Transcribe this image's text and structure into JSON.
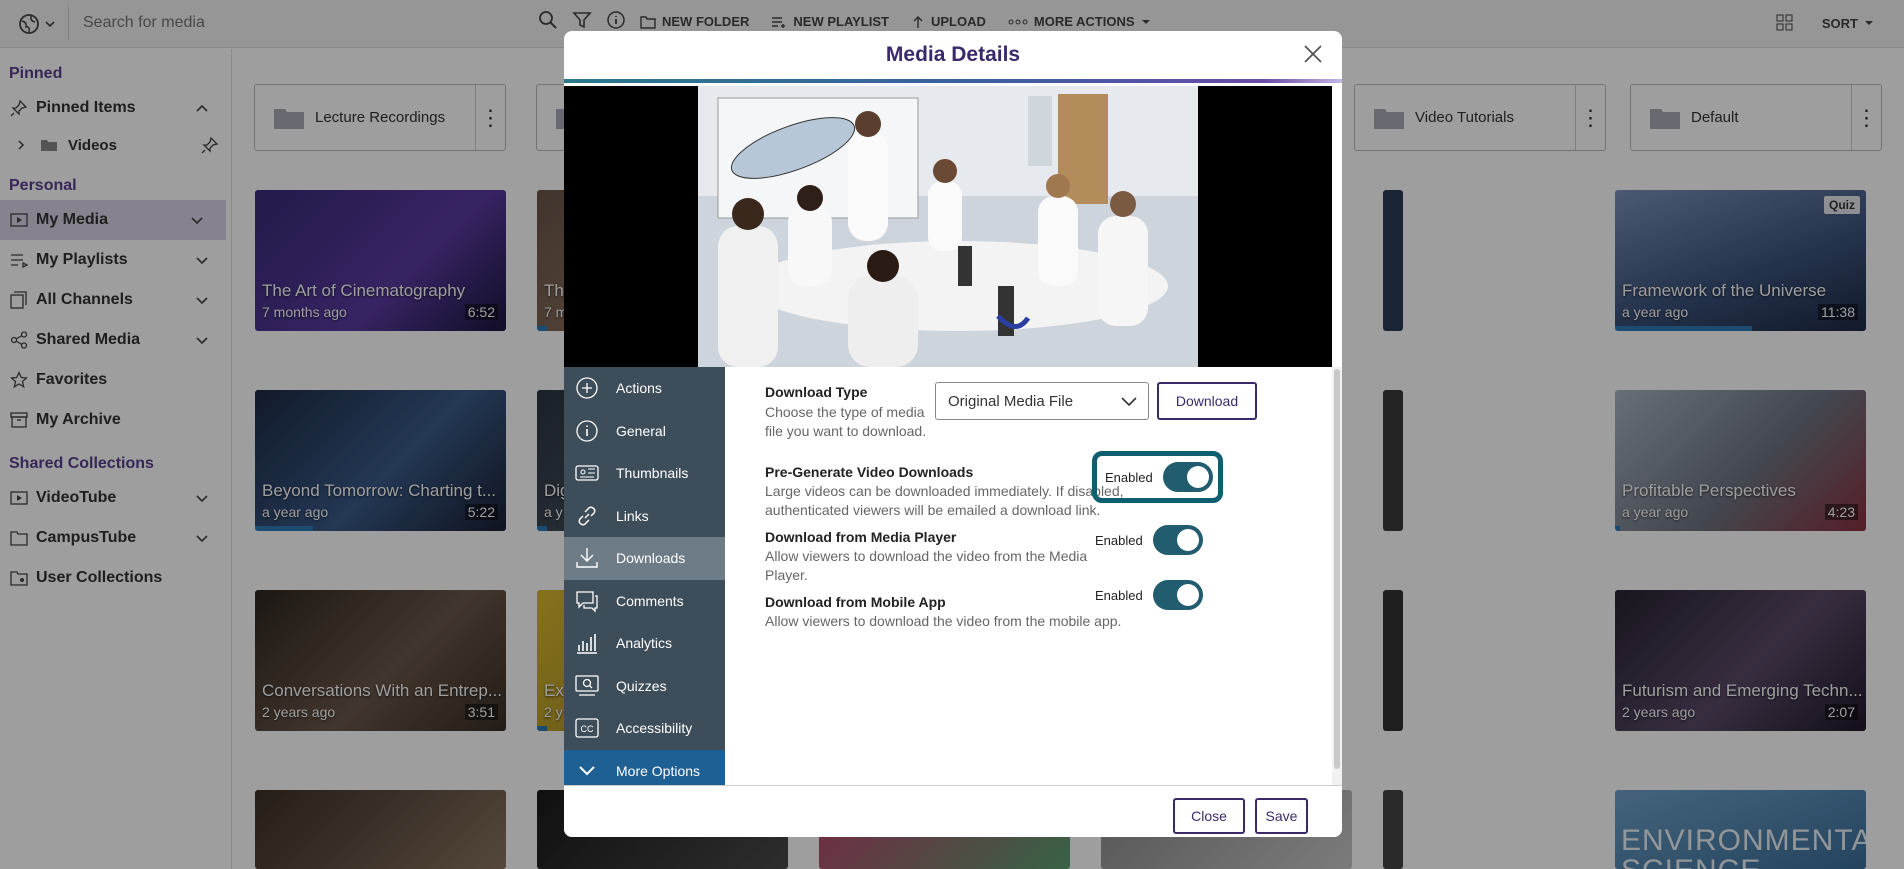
{
  "topbar": {
    "search_placeholder": "Search for media",
    "actions": [
      "NEW FOLDER",
      "NEW PLAYLIST",
      "UPLOAD",
      "MORE ACTIONS"
    ],
    "sort_label": "SORT"
  },
  "sidebar": {
    "pinned_header": "Pinned",
    "pinned_items_label": "Pinned Items",
    "pinned_sub": "Videos",
    "personal_header": "Personal",
    "personal_items": [
      "My Media",
      "My Playlists",
      "All Channels",
      "Shared Media",
      "Favorites",
      "My Archive"
    ],
    "shared_header": "Shared Collections",
    "shared_items": [
      "VideoTube",
      "CampusTube",
      "User Collections"
    ]
  },
  "folders": [
    "Lecture Recordings",
    "Video Tutorials",
    "Default"
  ],
  "media": [
    {
      "title": "The Art of Cinematography",
      "age": "7 months ago",
      "duration": "6:52"
    },
    {
      "title": "Th",
      "age": "7 m",
      "duration": ""
    },
    {
      "title": "Framework of the Universe",
      "age": "a year ago",
      "duration": "11:38",
      "quiz": "Quiz"
    },
    {
      "title": "Beyond Tomorrow: Charting t...",
      "age": "a year ago",
      "duration": "5:22"
    },
    {
      "title": "Dig",
      "age": "a y",
      "duration": ""
    },
    {
      "title": "Profitable Perspectives",
      "age": "a year ago",
      "duration": "4:23"
    },
    {
      "title": "Conversations With an Entrep...",
      "age": "2 years ago",
      "duration": "3:51"
    },
    {
      "title": "Ex",
      "age": "2 y",
      "duration": ""
    },
    {
      "title": "Futurism and Emerging Techn...",
      "age": "2 years ago",
      "duration": "2:07"
    },
    {
      "title": "ENVIRONMENTAL SCIENCE",
      "age": "",
      "duration": ""
    }
  ],
  "modal": {
    "title": "Media Details",
    "nav": [
      "Actions",
      "General",
      "Thumbnails",
      "Links",
      "Downloads",
      "Comments",
      "Analytics",
      "Quizzes",
      "Accessibility",
      "More Options"
    ],
    "download_type": {
      "label": "Download Type",
      "desc": "Choose the type of media file you want to download.",
      "selected": "Original Media File",
      "button": "Download"
    },
    "options": [
      {
        "label": "Pre-Generate Video Downloads",
        "desc": "Large videos can be downloaded immediately. If disabled, authenticated viewers will be emailed a download link.",
        "state": "Enabled"
      },
      {
        "label": "Download from Media Player",
        "desc": "Allow viewers to download the video from the Media Player.",
        "state": "Enabled"
      },
      {
        "label": "Download from Mobile App",
        "desc": "Allow viewers to download the video from the mobile app.",
        "state": "Enabled"
      }
    ],
    "footer": {
      "close": "Close",
      "save": "Save"
    }
  },
  "colors": {
    "brand_purple": "#3b2a6a",
    "toggle_on": "#215d6e",
    "nav_bg": "#3d4d5a",
    "progress": "#2e79b9"
  }
}
